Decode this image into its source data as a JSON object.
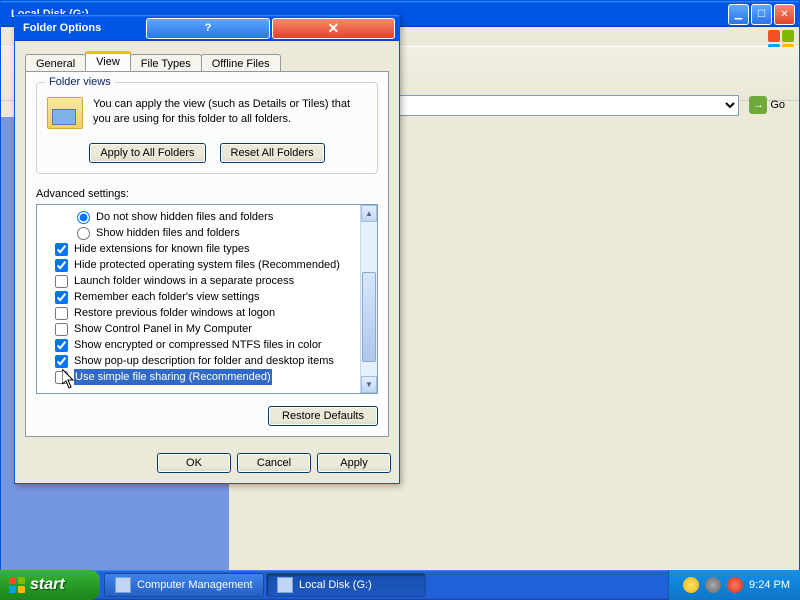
{
  "bg": {
    "title": "Local Disk (G:)",
    "go": "Go"
  },
  "dialog": {
    "title": "Folder Options",
    "tabs": [
      "General",
      "View",
      "File Types",
      "Offline Files"
    ],
    "folderViews": {
      "legend": "Folder views",
      "text1": "You can apply the view (such as Details or Tiles) that",
      "text2": "you are using for this folder to all folders.",
      "applyAll": "Apply to All Folders",
      "resetAll": "Reset All Folders"
    },
    "advLabel": "Advanced settings:",
    "items": {
      "radio1": "Do not show hidden files and folders",
      "radio2": "Show hidden files and folders",
      "c1": "Hide extensions for known file types",
      "c2": "Hide protected operating system files (Recommended)",
      "c3": "Launch folder windows in a separate process",
      "c4": "Remember each folder's view settings",
      "c5": "Restore previous folder windows at logon",
      "c6": "Show Control Panel in My Computer",
      "c7": "Show encrypted or compressed NTFS files in color",
      "c8": "Show pop-up description for folder and desktop items",
      "c9": "Use simple file sharing (Recommended)"
    },
    "restore": "Restore Defaults",
    "ok": "OK",
    "cancel": "Cancel",
    "apply": "Apply"
  },
  "taskbar": {
    "start": "start",
    "task1": "Computer Management",
    "task2": "Local Disk (G:)",
    "clock": "9:24 PM"
  }
}
